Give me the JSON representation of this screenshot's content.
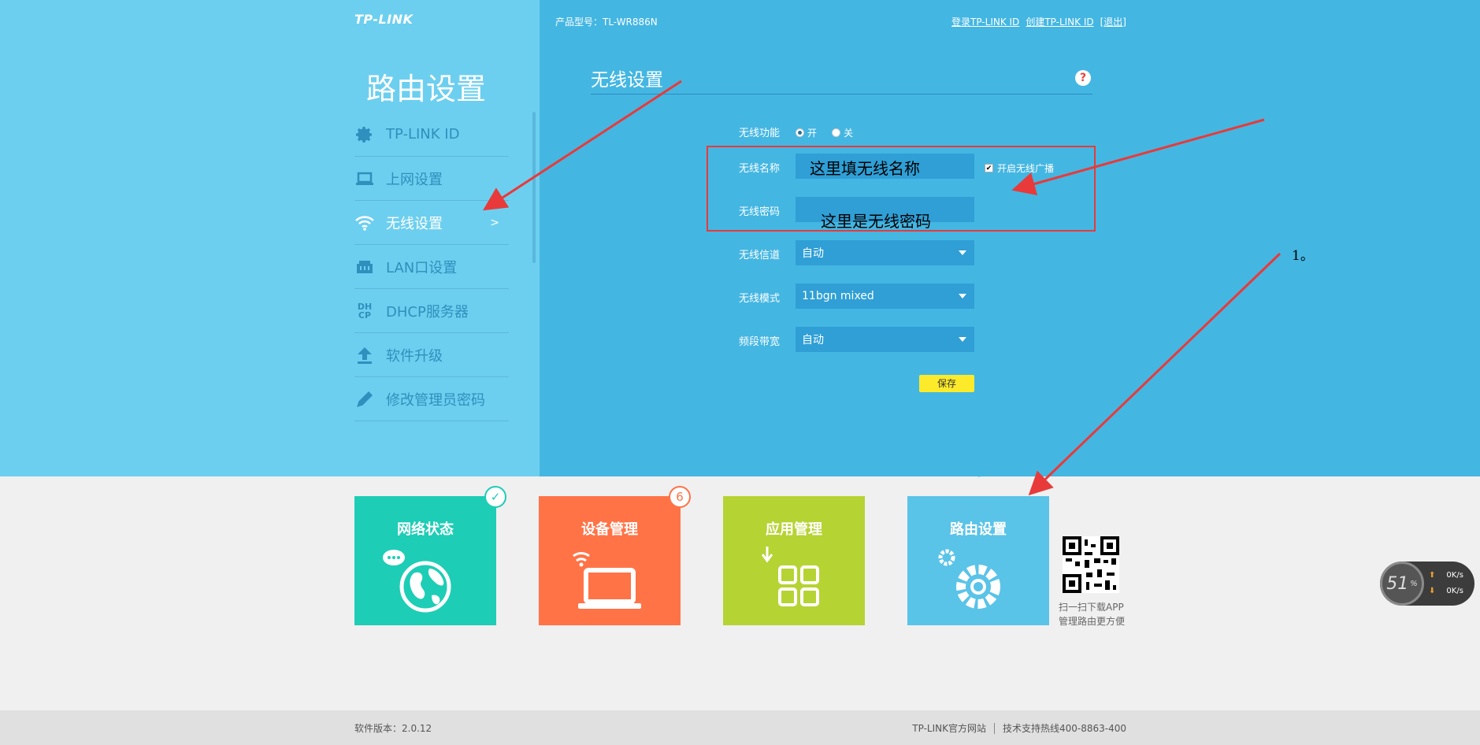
{
  "header": {
    "logo": "TP-LINK",
    "product": "产品型号：TL-WR886N",
    "account_links": [
      "登录TP-LINK ID",
      "创建TP-LINK ID",
      "[退出]"
    ]
  },
  "sidebar": {
    "title": "路由设置",
    "items": [
      {
        "label": "TP-LINK ID",
        "icon": "gear-icon"
      },
      {
        "label": "上网设置",
        "icon": "laptop-icon"
      },
      {
        "label": "无线设置",
        "icon": "wifi-icon",
        "active": true,
        "chevron": ">"
      },
      {
        "label": "LAN口设置",
        "icon": "lan-port-icon"
      },
      {
        "label": "DHCP服务器",
        "icon": "dhcp-icon",
        "icon_text": [
          "DH",
          "CP"
        ]
      },
      {
        "label": "软件升级",
        "icon": "upload-icon"
      },
      {
        "label": "修改管理员密码",
        "icon": "pencil-icon"
      }
    ]
  },
  "panel": {
    "title": "无线设置",
    "help": "?",
    "wireless_function": {
      "label": "无线功能",
      "options": [
        "开",
        "关"
      ],
      "selected": "开"
    },
    "ssid": {
      "label": "无线名称",
      "value": "",
      "broadcast_label": "开启无线广播",
      "broadcast_checked": true
    },
    "password": {
      "label": "无线密码",
      "value": ""
    },
    "channel": {
      "label": "无线信道",
      "value": "自动"
    },
    "mode": {
      "label": "无线模式",
      "value": "11bgn mixed"
    },
    "bandwidth": {
      "label": "频段带宽",
      "value": "自动"
    },
    "save_label": "保存"
  },
  "annotations": {
    "ssid_note": "这里填无线名称",
    "password_note": "这里是无线密码",
    "step_note": "1。",
    "arrow_color": "#e83a3a"
  },
  "tiles": [
    {
      "title": "网络状态",
      "color": "#1ecdb5",
      "badge": "✓",
      "icon": "globe-icon"
    },
    {
      "title": "设备管理",
      "color": "#ff7347",
      "badge": "6",
      "icon": "laptop-wifi-icon"
    },
    {
      "title": "应用管理",
      "color": "#b6d334",
      "badge": "",
      "icon": "apps-grid-icon"
    },
    {
      "title": "路由设置",
      "color": "#5ac3e8",
      "badge": "",
      "icon": "gears-icon"
    }
  ],
  "qr": {
    "caption": [
      "扫一扫下载APP",
      "管理路由更方便"
    ]
  },
  "footer": {
    "version": "软件版本：2.0.12",
    "site": "TP-LINK官方网站",
    "hotline": "技术支持热线400-8863-400"
  },
  "speed_widget": {
    "percent": "51",
    "unit": "%",
    "up": "0",
    "down": "0",
    "rate_unit": "K/s"
  }
}
